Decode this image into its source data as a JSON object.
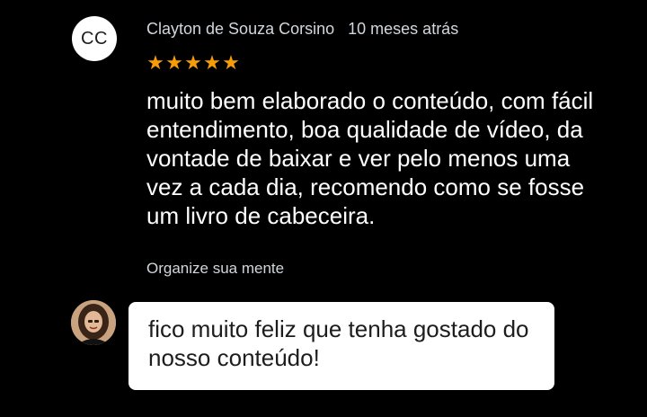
{
  "review": {
    "avatar_initials": "CC",
    "author": "Clayton de Souza Corsino",
    "date": "10 meses atrás",
    "rating": 5,
    "stars": [
      "★",
      "★",
      "★",
      "★",
      "★"
    ],
    "text": "muito bem elaborado o conteúdo, com fácil entendimento, boa qualidade de vídeo, da vontade de baixar e ver pelo menos uma vez a cada dia, recomendo como se fosse um livro de cabeceira.",
    "course": "Organize sua mente"
  },
  "reply": {
    "text": "fico muito feliz que tenha gostado do nosso conteúdo!"
  },
  "colors": {
    "background": "#000000",
    "star": "#f69c08",
    "meta_text": "#d1d7dc",
    "bubble_bg": "#ffffff"
  }
}
